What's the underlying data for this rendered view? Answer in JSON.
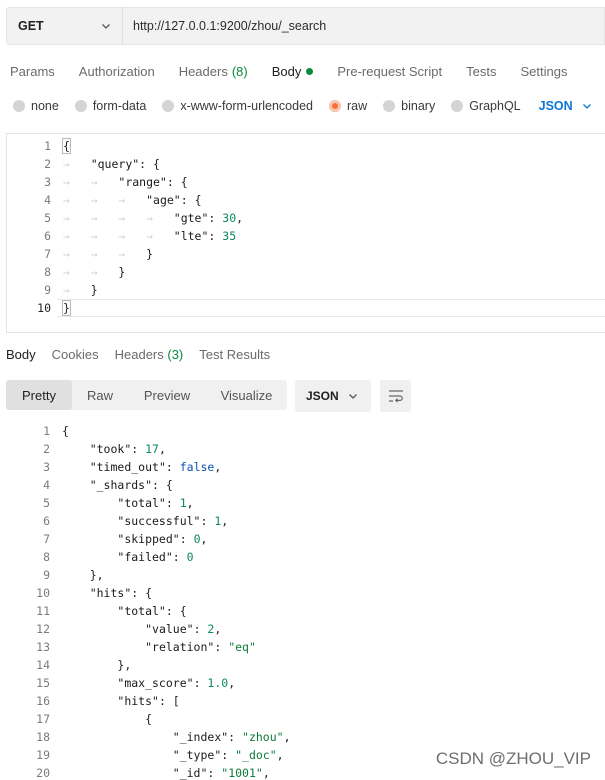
{
  "request": {
    "method": "GET",
    "url": "http://127.0.0.1:9200/zhou/_search"
  },
  "request_tabs": [
    {
      "label": "Params",
      "count": ""
    },
    {
      "label": "Authorization",
      "count": ""
    },
    {
      "label": "Headers",
      "count": "(8)"
    },
    {
      "label": "Body",
      "count": ""
    },
    {
      "label": "Pre-request Script",
      "count": ""
    },
    {
      "label": "Tests",
      "count": ""
    },
    {
      "label": "Settings",
      "count": ""
    }
  ],
  "active_request_tab": "Body",
  "body_types": [
    "none",
    "form-data",
    "x-www-form-urlencoded",
    "raw",
    "binary",
    "GraphQL"
  ],
  "selected_body_type": "raw",
  "body_format": "JSON",
  "request_body_lines": [
    {
      "n": "1",
      "indent": 0,
      "parts": [
        [
          "p",
          "{"
        ]
      ]
    },
    {
      "n": "2",
      "indent": 1,
      "parts": [
        [
          "k",
          "\"query\""
        ],
        [
          "p",
          ": {"
        ]
      ]
    },
    {
      "n": "3",
      "indent": 2,
      "parts": [
        [
          "k",
          "\"range\""
        ],
        [
          "p",
          ": {"
        ]
      ]
    },
    {
      "n": "4",
      "indent": 3,
      "parts": [
        [
          "k",
          "\"age\""
        ],
        [
          "p",
          ": {"
        ]
      ]
    },
    {
      "n": "5",
      "indent": 4,
      "parts": [
        [
          "k",
          "\"gte\""
        ],
        [
          "p",
          ": "
        ],
        [
          "n",
          "30"
        ],
        [
          "p",
          ","
        ]
      ]
    },
    {
      "n": "6",
      "indent": 4,
      "parts": [
        [
          "k",
          "\"lte\""
        ],
        [
          "p",
          ": "
        ],
        [
          "n",
          "35"
        ]
      ]
    },
    {
      "n": "7",
      "indent": 3,
      "parts": [
        [
          "p",
          "}"
        ]
      ]
    },
    {
      "n": "8",
      "indent": 2,
      "parts": [
        [
          "p",
          "}"
        ]
      ]
    },
    {
      "n": "9",
      "indent": 1,
      "parts": [
        [
          "p",
          "}"
        ]
      ]
    },
    {
      "n": "10",
      "indent": 0,
      "parts": [
        [
          "p",
          "}"
        ]
      ]
    }
  ],
  "response_tabs": [
    {
      "label": "Body",
      "count": ""
    },
    {
      "label": "Cookies",
      "count": ""
    },
    {
      "label": "Headers",
      "count": "(3)"
    },
    {
      "label": "Test Results",
      "count": ""
    }
  ],
  "view_modes": [
    "Pretty",
    "Raw",
    "Preview",
    "Visualize"
  ],
  "active_view_mode": "Pretty",
  "response_format": "JSON",
  "response_body_lines": [
    {
      "n": "1",
      "indent": 0,
      "parts": [
        [
          "p",
          "{"
        ]
      ]
    },
    {
      "n": "2",
      "indent": 1,
      "parts": [
        [
          "k",
          "\"took\""
        ],
        [
          "p",
          ": "
        ],
        [
          "n",
          "17"
        ],
        [
          "p",
          ","
        ]
      ]
    },
    {
      "n": "3",
      "indent": 1,
      "parts": [
        [
          "k",
          "\"timed_out\""
        ],
        [
          "p",
          ": "
        ],
        [
          "b",
          "false"
        ],
        [
          "p",
          ","
        ]
      ]
    },
    {
      "n": "4",
      "indent": 1,
      "parts": [
        [
          "k",
          "\"_shards\""
        ],
        [
          "p",
          ": {"
        ]
      ]
    },
    {
      "n": "5",
      "indent": 2,
      "parts": [
        [
          "k",
          "\"total\""
        ],
        [
          "p",
          ": "
        ],
        [
          "n",
          "1"
        ],
        [
          "p",
          ","
        ]
      ]
    },
    {
      "n": "6",
      "indent": 2,
      "parts": [
        [
          "k",
          "\"successful\""
        ],
        [
          "p",
          ": "
        ],
        [
          "n",
          "1"
        ],
        [
          "p",
          ","
        ]
      ]
    },
    {
      "n": "7",
      "indent": 2,
      "parts": [
        [
          "k",
          "\"skipped\""
        ],
        [
          "p",
          ": "
        ],
        [
          "n",
          "0"
        ],
        [
          "p",
          ","
        ]
      ]
    },
    {
      "n": "8",
      "indent": 2,
      "parts": [
        [
          "k",
          "\"failed\""
        ],
        [
          "p",
          ": "
        ],
        [
          "n",
          "0"
        ]
      ]
    },
    {
      "n": "9",
      "indent": 1,
      "parts": [
        [
          "p",
          "},"
        ]
      ]
    },
    {
      "n": "10",
      "indent": 1,
      "parts": [
        [
          "k",
          "\"hits\""
        ],
        [
          "p",
          ": {"
        ]
      ]
    },
    {
      "n": "11",
      "indent": 2,
      "parts": [
        [
          "k",
          "\"total\""
        ],
        [
          "p",
          ": {"
        ]
      ]
    },
    {
      "n": "12",
      "indent": 3,
      "parts": [
        [
          "k",
          "\"value\""
        ],
        [
          "p",
          ": "
        ],
        [
          "n",
          "2"
        ],
        [
          "p",
          ","
        ]
      ]
    },
    {
      "n": "13",
      "indent": 3,
      "parts": [
        [
          "k",
          "\"relation\""
        ],
        [
          "p",
          ": "
        ],
        [
          "s",
          "\"eq\""
        ]
      ]
    },
    {
      "n": "14",
      "indent": 2,
      "parts": [
        [
          "p",
          "},"
        ]
      ]
    },
    {
      "n": "15",
      "indent": 2,
      "parts": [
        [
          "k",
          "\"max_score\""
        ],
        [
          "p",
          ": "
        ],
        [
          "n",
          "1.0"
        ],
        [
          "p",
          ","
        ]
      ]
    },
    {
      "n": "16",
      "indent": 2,
      "parts": [
        [
          "k",
          "\"hits\""
        ],
        [
          "p",
          ": ["
        ]
      ]
    },
    {
      "n": "17",
      "indent": 3,
      "parts": [
        [
          "p",
          "{"
        ]
      ]
    },
    {
      "n": "18",
      "indent": 4,
      "parts": [
        [
          "k",
          "\"_index\""
        ],
        [
          "p",
          ": "
        ],
        [
          "s",
          "\"zhou\""
        ],
        [
          "p",
          ","
        ]
      ]
    },
    {
      "n": "19",
      "indent": 4,
      "parts": [
        [
          "k",
          "\"_type\""
        ],
        [
          "p",
          ": "
        ],
        [
          "s",
          "\"_doc\""
        ],
        [
          "p",
          ","
        ]
      ]
    },
    {
      "n": "20",
      "indent": 4,
      "parts": [
        [
          "k",
          "\"_id\""
        ],
        [
          "p",
          ": "
        ],
        [
          "s",
          "\"1001\""
        ],
        [
          "p",
          ","
        ]
      ]
    }
  ],
  "watermark": "CSDN @ZHOU_VIP",
  "colors": {
    "accent_orange": "#ff6c37",
    "link_blue": "#0c76d6",
    "count_green": "#0b8a3f"
  }
}
